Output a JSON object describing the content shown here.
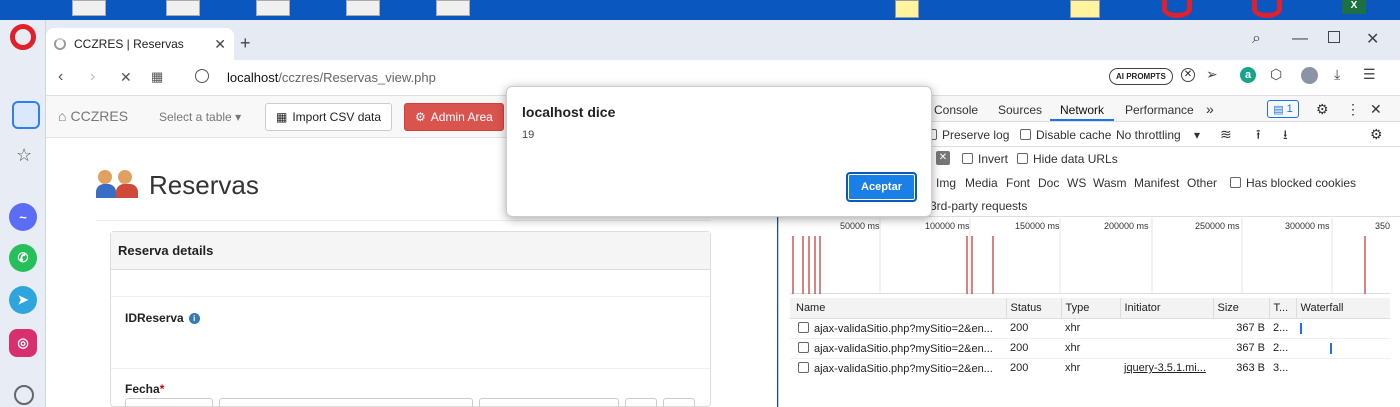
{
  "browser": {
    "tab_title": "CCZRES | Reservas",
    "url_host": "localhost",
    "url_path": "/cczres/Reservas_view.php",
    "ai_prompts": "AI PROMPTS"
  },
  "app": {
    "brand": "CCZRES",
    "select_table": "Select a table",
    "import_csv": "Import CSV data",
    "admin_area": "Admin Area",
    "page_title": "Reservas",
    "panel_title": "Reserva details",
    "field_idreserva": "IDReserva",
    "field_fecha": "Fecha",
    "required_mark": "*"
  },
  "dialog": {
    "title": "localhost dice",
    "message": "19",
    "ok_label": "Aceptar"
  },
  "devtools": {
    "tabs": [
      "Console",
      "Sources",
      "Network",
      "Performance"
    ],
    "more": "»",
    "issues_count": "1",
    "preserve_log": "Preserve log",
    "disable_cache": "Disable cache",
    "throttling": "No throttling",
    "invert": "Invert",
    "hide_data_urls": "Hide data URLs",
    "filters": [
      "Img",
      "Media",
      "Font",
      "Doc",
      "WS",
      "Wasm",
      "Manifest",
      "Other"
    ],
    "blocked_cookies": "Has blocked cookies",
    "third_party": "3rd-party requests",
    "timeline_ticks": [
      "50000 ms",
      "100000 ms",
      "150000 ms",
      "200000 ms",
      "250000 ms",
      "300000 ms",
      "350"
    ],
    "columns": [
      "Name",
      "Status",
      "Type",
      "Initiator",
      "Size",
      "T...",
      "Waterfall"
    ],
    "rows": [
      {
        "name": "ajax-validaSitio.php?mySitio=2&en...",
        "status": "200",
        "type": "xhr",
        "initiator": "",
        "size": "367 B",
        "time": "2..."
      },
      {
        "name": "ajax-validaSitio.php?mySitio=2&en...",
        "status": "200",
        "type": "xhr",
        "initiator": "",
        "size": "367 B",
        "time": "2..."
      },
      {
        "name": "ajax-validaSitio.php?mySitio=2&en...",
        "status": "200",
        "type": "xhr",
        "initiator": "jquery-3.5.1.mi...",
        "size": "363 B",
        "time": "3..."
      }
    ]
  }
}
